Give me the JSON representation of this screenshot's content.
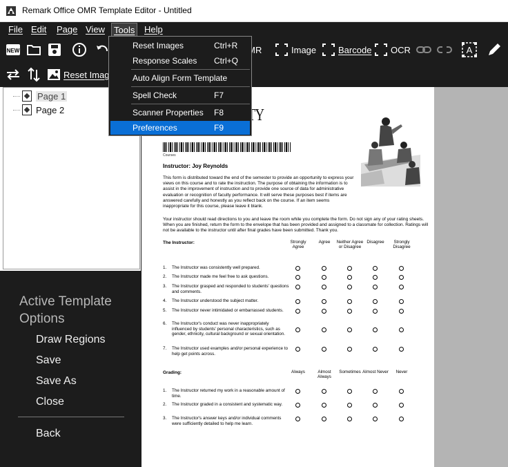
{
  "window": {
    "title": "Remark Office OMR Template Editor - Untitled"
  },
  "menu": [
    "File",
    "Edit",
    "Page",
    "View",
    "Tools",
    "Help"
  ],
  "toolbar": {
    "omr": "OMR",
    "image": "Image",
    "barcode": "Barcode",
    "ocr": "OCR",
    "new_icon": "NEW"
  },
  "subbar": {
    "reset_images": "Reset Images"
  },
  "tree": {
    "pages": [
      "Page 1",
      "Page 2"
    ]
  },
  "left_panel": {
    "heading": "Active Template Options",
    "items": [
      "Draw Regions",
      "Save",
      "Save As",
      "Close"
    ],
    "back": "Back"
  },
  "tools_menu": [
    {
      "label": "Reset Images",
      "shortcut": "Ctrl+R"
    },
    {
      "label": "Response Scales",
      "shortcut": "Ctrl+Q"
    },
    {
      "label": "Auto Align Form Template",
      "shortcut": ""
    },
    {
      "label": "Spell Check",
      "shortcut": "F7"
    },
    {
      "label": "Scanner Properties",
      "shortcut": "F8"
    },
    {
      "label": "Preferences",
      "shortcut": "F9"
    }
  ],
  "form": {
    "title": "RSITY",
    "course_label": "Courses",
    "instructor": "Instructor: Joy Reynolds",
    "intro": "This form is distributed toward the end of the semester to provide an opportunity to express your views on this course and to rate the instruction. The purpose of obtaining the information is to assist in the improvement of instruction and to provide one source of data for administrative evaluation or recognition of faculty performance.  It will serve these purposes best if items are answered carefully and honestly as you reflect back on the course. If an item seems inappropriate for this course, please leave it blank.",
    "directions": "Your instructor should read directions to you and leave the room while you complete the form. Do not sign any of your rating sheets. When you are finished, return the form to the envelope that has been provided and assigned to a classmate for collection. Ratings will not be available to the instructor until after final grades have been submitted. Thank you.",
    "section1": "The Instructor:",
    "scale1": [
      "Strongly Agree",
      "Agree",
      "Neither Agree or Disagree",
      "Disagree",
      "Strongly Disagree"
    ],
    "questions1": [
      {
        "n": "1.",
        "t": "The Instructor was consistently well prepared."
      },
      {
        "n": "2.",
        "t": "The Instructor made me feel free to ask questions."
      },
      {
        "n": "3.",
        "t": "The Instructor grasped and responded to students' questions and comments."
      },
      {
        "n": "4.",
        "t": "The Instructor understood the subject matter."
      },
      {
        "n": "5.",
        "t": "The Instructor never intimidated or embarrassed students."
      },
      {
        "n": "6.",
        "t": "The Instructor's conduct was never inappropriately influenced by students' personal characteristics, such as gender, ethnicity, cultural background or sexual orientation."
      },
      {
        "n": "7.",
        "t": "The Instructor used examples and/or personal experience to help get points across."
      }
    ],
    "section2": "Grading:",
    "scale2": [
      "Always",
      "Almost Always",
      "Sometimes",
      "Almost Never",
      "Never"
    ],
    "questions2": [
      {
        "n": "1.",
        "t": "The Instructor returned my work in a reasonable amount of time."
      },
      {
        "n": "2.",
        "t": "The Instructor graded in a consistent and systematic way."
      },
      {
        "n": "3.",
        "t": "The Instructor's answer keys and/or individual comments were sufficiently detailed to help me learn."
      }
    ]
  }
}
